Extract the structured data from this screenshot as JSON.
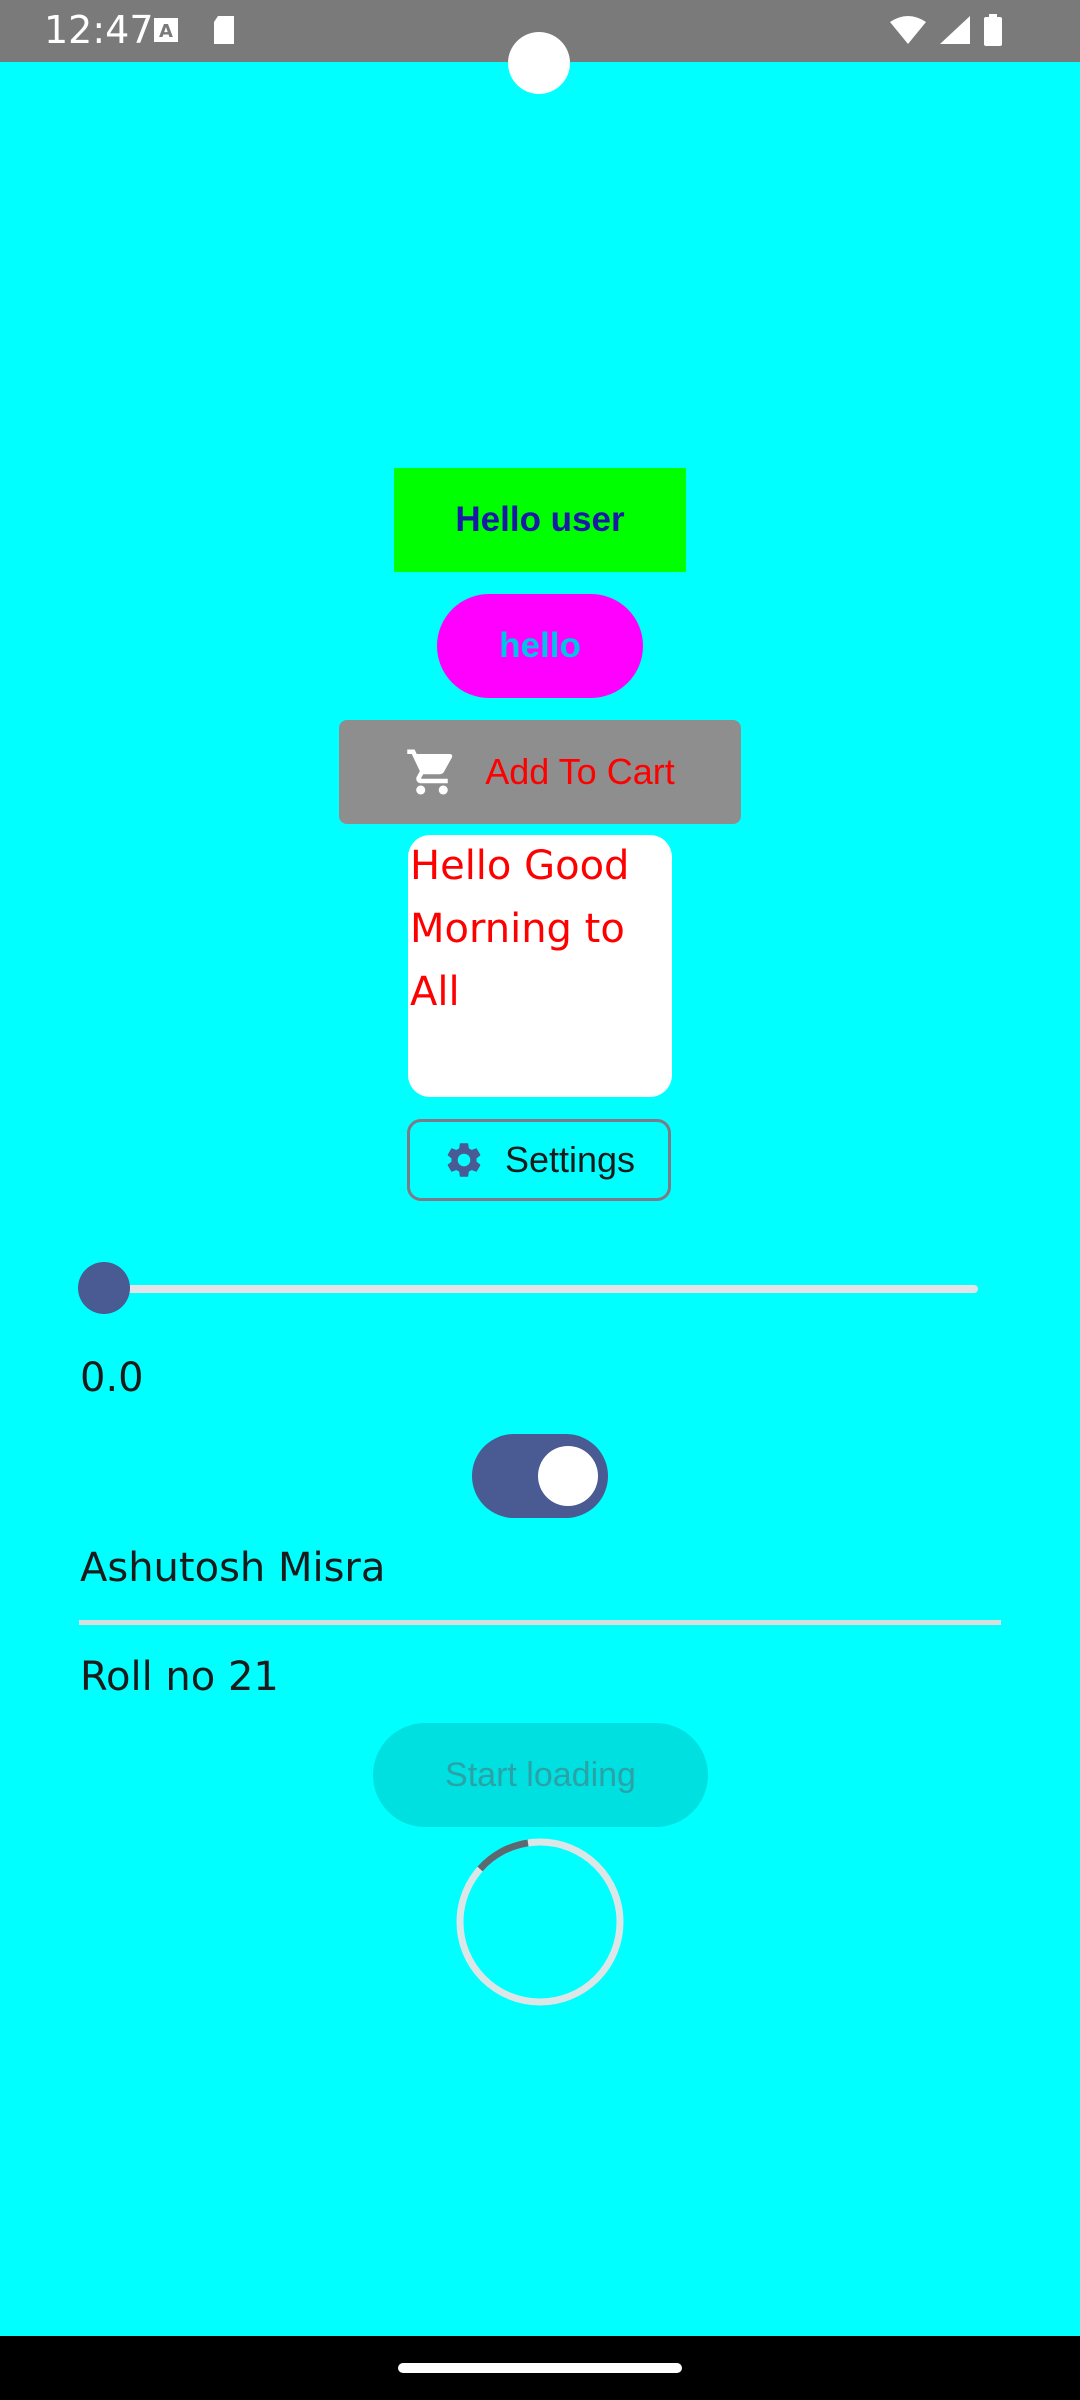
{
  "status_bar": {
    "time": "12:47",
    "icons": [
      "text-notification-icon",
      "sd-card-icon",
      "wifi-icon",
      "signal-icon",
      "battery-icon"
    ]
  },
  "main": {
    "hello_user_label": "Hello user",
    "hello_pill_label": "hello",
    "add_to_cart": {
      "label": "Add To Cart",
      "icon": "cart-icon"
    },
    "note_text": "Hello Good Morning to All",
    "settings": {
      "label": "Settings",
      "icon": "gear-icon"
    },
    "slider": {
      "value": 0.0
    },
    "slider_value_text": "0.0",
    "switch": {
      "on": true
    },
    "name_text": "Ashutosh Misra",
    "roll_text": "Roll no 21",
    "start_loading_label": "Start loading"
  },
  "colors": {
    "background": "#00FFFF",
    "hello_user_bg": "#00FF00",
    "hello_pill_bg": "#FF00FF",
    "cart_text": "#FF0000",
    "accent": "#4A5A92"
  }
}
